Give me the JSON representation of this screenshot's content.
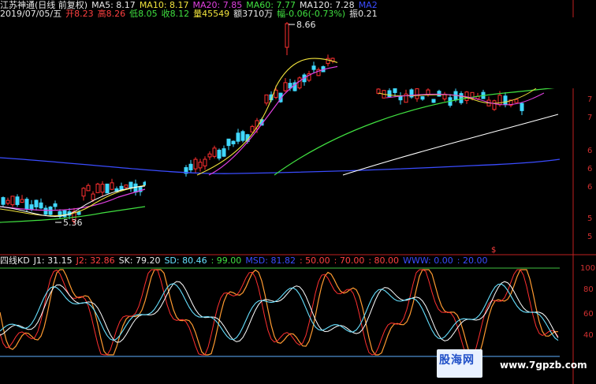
{
  "header": {
    "title": "江苏神通(日线 前复权)",
    "ma5": "MA5: 8.17",
    "ma10": "MA10: 8.17",
    "ma20": "MA20: 7.85",
    "ma60": "MA60: 7.77",
    "ma120": "MA120: 7.28",
    "ma_more": "MA2",
    "date": "2019/07/05/五",
    "open": "开8.23",
    "high": "高8.26",
    "low": "低8.05",
    "close": "收8.12",
    "volume": "量45549",
    "amount": "额3710万",
    "change": "幅-0.06(-0.73%)",
    "amplitude": "振0.21"
  },
  "price_labels": {
    "high": "8.66",
    "low": "5.36"
  },
  "kd_header": {
    "name": "四线KD",
    "j1": "J1: 31.15",
    "j2": "J2: 32.86",
    "sk": "SK: 79.20",
    "sd": "SD: 80.46",
    "l99": ": 99.00",
    "msd": "MSD: 81.82",
    "l50": ": 50.00",
    "l70": ": 70.00",
    "l80": ": 80.00",
    "www": "WWW: 0.00",
    "l20": ": 20.00"
  },
  "right_axis": [
    "7",
    "7",
    "6",
    "6",
    "6",
    "5",
    "5"
  ],
  "indicator_axis": [
    "100",
    "80",
    "60",
    "40"
  ],
  "signal_mark": "$",
  "watermark": {
    "logo": "股海网",
    "url": "www.7gpzb.com"
  },
  "colors": {
    "up": "#ff3030",
    "down": "#40d8ff",
    "ma5": "#ffffff",
    "ma10": "#f0e23c",
    "ma20": "#e040e0",
    "ma60": "#40e040",
    "ma120": "#3a4cff",
    "grid": "#c02020"
  },
  "chart_data": {
    "type": "candlestick",
    "price_range_visible": [
      5.36,
      8.66
    ],
    "series": [
      {
        "name": "MA5",
        "values": [
          8.17
        ]
      },
      {
        "name": "MA10",
        "values": [
          8.17
        ]
      },
      {
        "name": "MA20",
        "values": [
          7.85
        ]
      },
      {
        "name": "MA60",
        "values": [
          7.77
        ]
      },
      {
        "name": "MA120",
        "values": [
          7.28
        ]
      }
    ],
    "kd_values": {
      "J1": 31.15,
      "J2": 32.86,
      "SK": 79.2,
      "SD": 80.46,
      "MSD": 81.82
    },
    "kd_levels": [
      99,
      50,
      70,
      80,
      20,
      0
    ]
  }
}
